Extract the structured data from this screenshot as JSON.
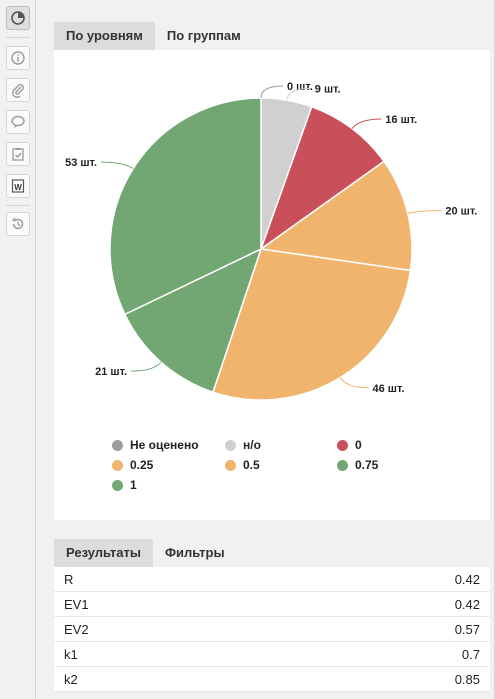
{
  "toolbar": {
    "items": [
      {
        "name": "chart-icon",
        "active": true
      },
      {
        "name": "info-icon",
        "active": false
      },
      {
        "name": "attachment-icon",
        "active": false
      },
      {
        "name": "comments-icon",
        "active": false
      },
      {
        "name": "clipboard-check-icon",
        "active": false
      },
      {
        "name": "word-document-icon",
        "active": false,
        "glyph": "W"
      },
      {
        "name": "history-icon",
        "active": false
      }
    ]
  },
  "chart_tabs": [
    {
      "label": "По уровням",
      "active": true
    },
    {
      "label": "По группам",
      "active": false
    }
  ],
  "chart_data": {
    "type": "pie",
    "slices": [
      {
        "label": "Не оценено",
        "value": 0,
        "data_label": "0 шт.",
        "color": "#9e9e9e"
      },
      {
        "label": "н/о",
        "value": 9,
        "data_label": "9 шт.",
        "color": "#d0d0d0"
      },
      {
        "label": "0",
        "value": 16,
        "data_label": "16 шт.",
        "color": "#c94f5a"
      },
      {
        "label": "0.25",
        "value": 20,
        "data_label": "20 шт.",
        "color": "#f0b46d"
      },
      {
        "label": "0.5",
        "value": 46,
        "data_label": "46 шт.",
        "color": "#f0b46d"
      },
      {
        "label": "0.75",
        "value": 21,
        "data_label": "21 шт.",
        "color": "#72a774"
      },
      {
        "label": "1",
        "value": 53,
        "data_label": "53 шт.",
        "color": "#72a774"
      }
    ]
  },
  "legend": [
    {
      "label": "Не оценено",
      "color": "#9e9e9e"
    },
    {
      "label": "н/о",
      "color": "#d0d0d0"
    },
    {
      "label": "0",
      "color": "#c94f5a"
    },
    {
      "label": "0.25",
      "color": "#f0b46d"
    },
    {
      "label": "0.5",
      "color": "#f0b46d"
    },
    {
      "label": "0.75",
      "color": "#72a774"
    },
    {
      "label": "1",
      "color": "#72a774"
    }
  ],
  "results_tabs": [
    {
      "label": "Результаты",
      "active": true
    },
    {
      "label": "Фильтры",
      "active": false
    }
  ],
  "results": [
    {
      "name": "R",
      "value": "0.42"
    },
    {
      "name": "EV1",
      "value": "0.42"
    },
    {
      "name": "EV2",
      "value": "0.57"
    },
    {
      "name": "k1",
      "value": "0.7"
    },
    {
      "name": "k2",
      "value": "0.85"
    }
  ]
}
